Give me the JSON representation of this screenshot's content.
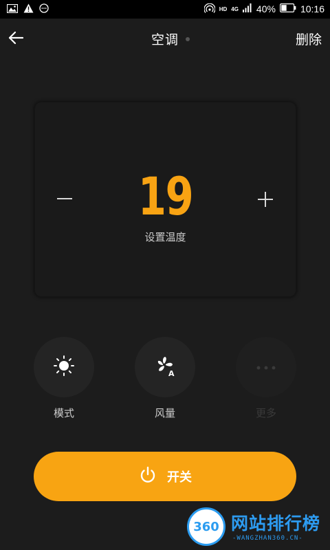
{
  "status_bar": {
    "battery_percent": "40%",
    "time": "10:16",
    "network_type": "4G",
    "hd_label": "HD",
    "icons": [
      "image-icon",
      "warning-icon",
      "message-icon",
      "hotspot-icon",
      "signal-icon",
      "battery-icon"
    ]
  },
  "header": {
    "title": "空调",
    "delete_label": "删除"
  },
  "temperature": {
    "value": "19",
    "label": "设置温度",
    "color": "#f8a313"
  },
  "controls": [
    {
      "label": "模式",
      "icon": "sun-icon",
      "enabled": true
    },
    {
      "label": "风量",
      "icon": "fan-auto-icon",
      "enabled": true
    },
    {
      "label": "更多",
      "icon": "more-icon",
      "enabled": false
    }
  ],
  "power": {
    "label": "开关",
    "color": "#f8a412"
  },
  "watermark": {
    "logo_text": "360",
    "title": "网站排行榜",
    "subtitle": "-WANGZHAN360.CN-"
  }
}
